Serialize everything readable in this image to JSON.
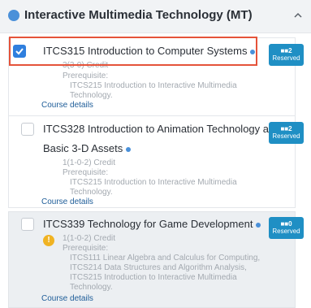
{
  "section": {
    "title": "Interactive Multimedia Technology (MT)"
  },
  "courses": [
    {
      "title": "ITCS315 Introduction to Computer Systems",
      "credit": "3(3-0) Credit",
      "prereq_label": "Prerequisite:",
      "prereqs": [
        "ITCS215 Introduction to Interactive Multimedia",
        "Technology."
      ],
      "details": "Course details",
      "reserved_count": "2",
      "reserved_label": "Reserved",
      "checked": true
    },
    {
      "title_line1": "ITCS328 Introduction to Animation Technology and",
      "title_line2": "Basic 3-D Assets",
      "credit": "1(1-0-2) Credit",
      "prereq_label": "Prerequisite:",
      "prereqs": [
        "ITCS215 Introduction to Interactive Multimedia",
        "Technology."
      ],
      "details": "Course details",
      "reserved_count": "2",
      "reserved_label": "Reserved",
      "checked": false
    },
    {
      "title": "ITCS339 Technology for Game Development",
      "credit": "1(1-0-2) Credit",
      "prereq_label": "Prerequisite:",
      "prereqs": [
        "ITCS111 Linear Algebra and Calculus for Computing,",
        "ITCS214 Data Structures and Algorithm Analysis,",
        "ITCS215 Introduction to Interactive Multimedia",
        "Technology."
      ],
      "details": "Course details",
      "reserved_count": "0",
      "reserved_label": "Reserved",
      "checked": false,
      "warning_glyph": "!"
    }
  ]
}
